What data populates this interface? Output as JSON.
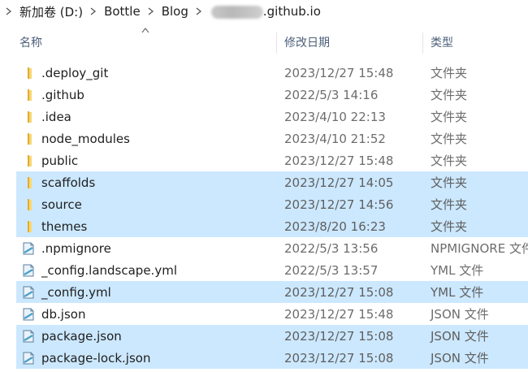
{
  "breadcrumb": {
    "drive": "新加卷 (D:)",
    "items": [
      "Bottle",
      "Blog"
    ],
    "repo_suffix": ".github.io"
  },
  "columns": {
    "name": "名称",
    "modified": "修改日期",
    "type": "类型"
  },
  "files": [
    {
      "name": ".deploy_git",
      "date": "2023/12/27 15:48",
      "type": "文件夹",
      "kind": "folder",
      "selected": false
    },
    {
      "name": ".github",
      "date": "2022/5/3 14:16",
      "type": "文件夹",
      "kind": "folder",
      "selected": false
    },
    {
      "name": ".idea",
      "date": "2023/4/10 22:13",
      "type": "文件夹",
      "kind": "folder",
      "selected": false
    },
    {
      "name": "node_modules",
      "date": "2023/4/10 21:52",
      "type": "文件夹",
      "kind": "folder",
      "selected": false
    },
    {
      "name": "public",
      "date": "2023/12/27 15:48",
      "type": "文件夹",
      "kind": "folder",
      "selected": false
    },
    {
      "name": "scaffolds",
      "date": "2023/12/27 14:05",
      "type": "文件夹",
      "kind": "folder",
      "selected": true
    },
    {
      "name": "source",
      "date": "2023/12/27 14:56",
      "type": "文件夹",
      "kind": "folder",
      "selected": true
    },
    {
      "name": "themes",
      "date": "2023/8/20 16:23",
      "type": "文件夹",
      "kind": "folder",
      "selected": true
    },
    {
      "name": ".npmignore",
      "date": "2022/5/3 13:56",
      "type": "NPMIGNORE 文件",
      "kind": "file",
      "selected": false
    },
    {
      "name": "_config.landscape.yml",
      "date": "2022/5/3 13:57",
      "type": "YML 文件",
      "kind": "file",
      "selected": false
    },
    {
      "name": "_config.yml",
      "date": "2023/12/27 15:08",
      "type": "YML 文件",
      "kind": "file",
      "selected": true
    },
    {
      "name": "db.json",
      "date": "2023/12/27 15:48",
      "type": "JSON 文件",
      "kind": "file",
      "selected": false
    },
    {
      "name": "package.json",
      "date": "2023/12/27 15:08",
      "type": "JSON 文件",
      "kind": "file",
      "selected": true
    },
    {
      "name": "package-lock.json",
      "date": "2023/12/27 15:08",
      "type": "JSON 文件",
      "kind": "file",
      "selected": true
    }
  ],
  "colors": {
    "selection": "#cce8ff",
    "header_text": "#4c607a",
    "folder": "#f8d775"
  }
}
